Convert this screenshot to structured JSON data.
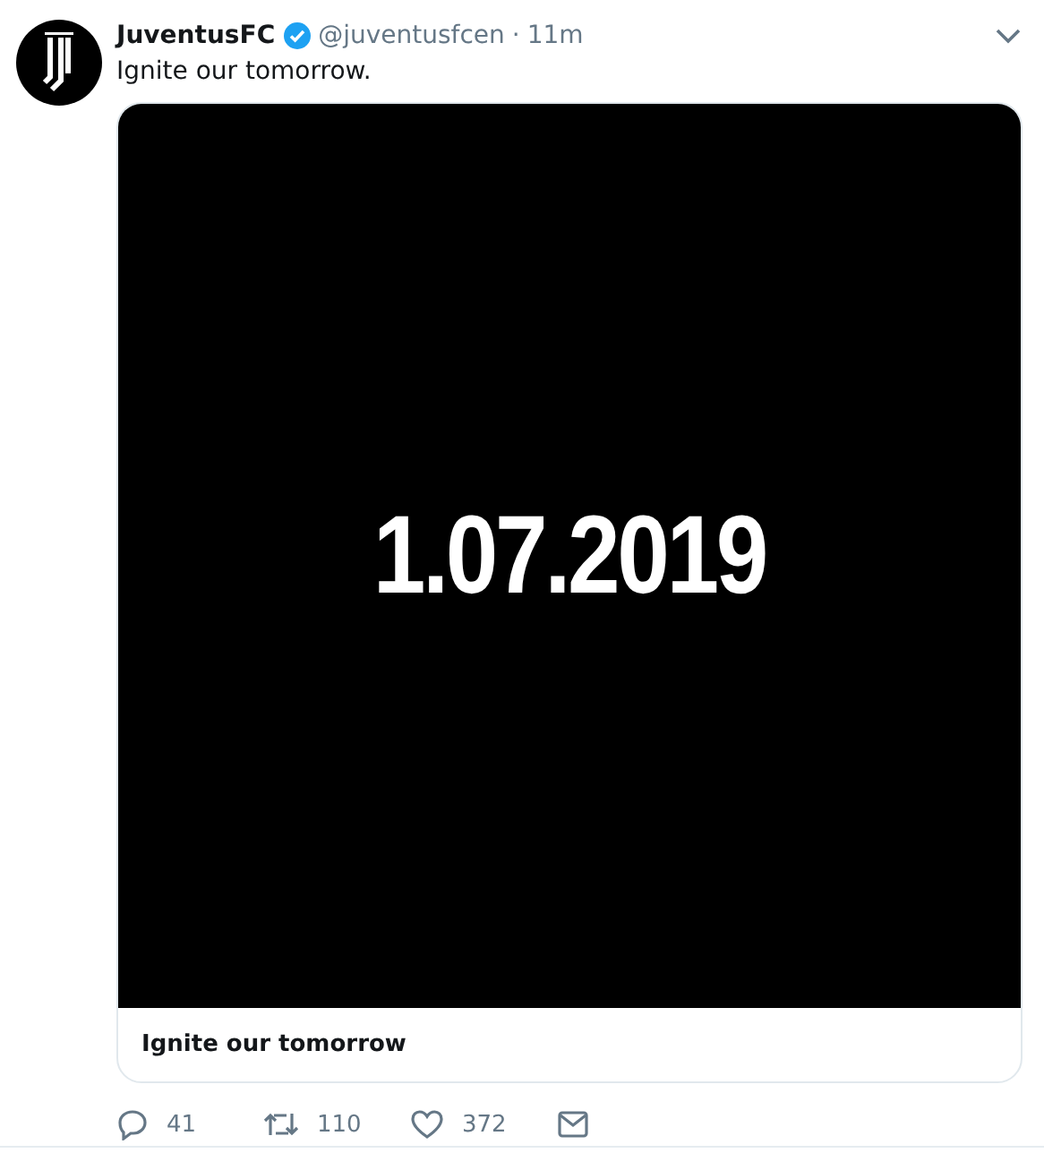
{
  "tweet": {
    "author": {
      "name": "JuventusFC",
      "verified": true,
      "handle": "@juventusfcen",
      "separator": "·",
      "time": "11m"
    },
    "text": "Ignite our tomorrow.",
    "card": {
      "image_text": "1.07.2019",
      "title": "Ignite our tomorrow"
    },
    "actions": [
      {
        "kind": "reply",
        "count": "41"
      },
      {
        "kind": "retweet",
        "count": "110"
      },
      {
        "kind": "like",
        "count": "372"
      },
      {
        "kind": "message"
      }
    ]
  }
}
